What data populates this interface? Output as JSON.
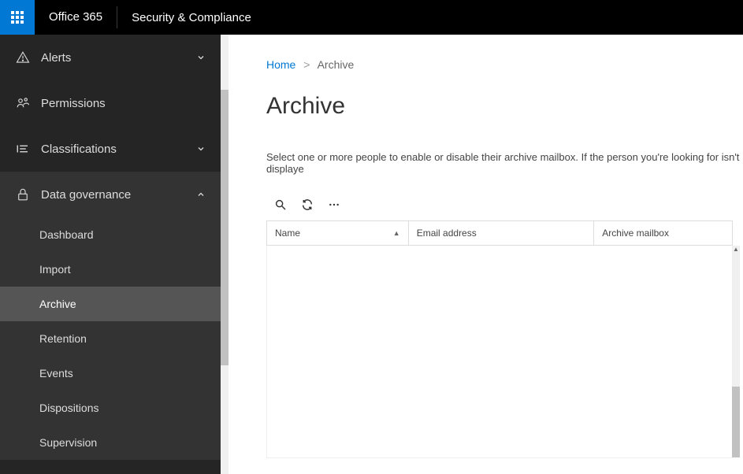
{
  "topbar": {
    "brand": "Office 365",
    "app_name": "Security & Compliance"
  },
  "sidebar": {
    "items": [
      {
        "icon": "alert",
        "label": "Alerts",
        "expandable": true,
        "expanded": false
      },
      {
        "icon": "permissions",
        "label": "Permissions",
        "expandable": false
      },
      {
        "icon": "classifications",
        "label": "Classifications",
        "expandable": true,
        "expanded": false
      },
      {
        "icon": "lock",
        "label": "Data governance",
        "expandable": true,
        "expanded": true,
        "children": [
          {
            "label": "Dashboard",
            "active": false
          },
          {
            "label": "Import",
            "active": false
          },
          {
            "label": "Archive",
            "active": true
          },
          {
            "label": "Retention",
            "active": false
          },
          {
            "label": "Events",
            "active": false
          },
          {
            "label": "Dispositions",
            "active": false
          },
          {
            "label": "Supervision",
            "active": false
          }
        ]
      }
    ]
  },
  "breadcrumb": {
    "home": "Home",
    "current": "Archive"
  },
  "page": {
    "title": "Archive",
    "description": "Select one or more people to enable or disable their archive mailbox. If the person you're looking for isn't displaye"
  },
  "table": {
    "columns": [
      {
        "label": "Name",
        "sorted": true
      },
      {
        "label": "Email address",
        "sorted": false
      },
      {
        "label": "Archive mailbox",
        "sorted": false
      }
    ],
    "rows": []
  }
}
